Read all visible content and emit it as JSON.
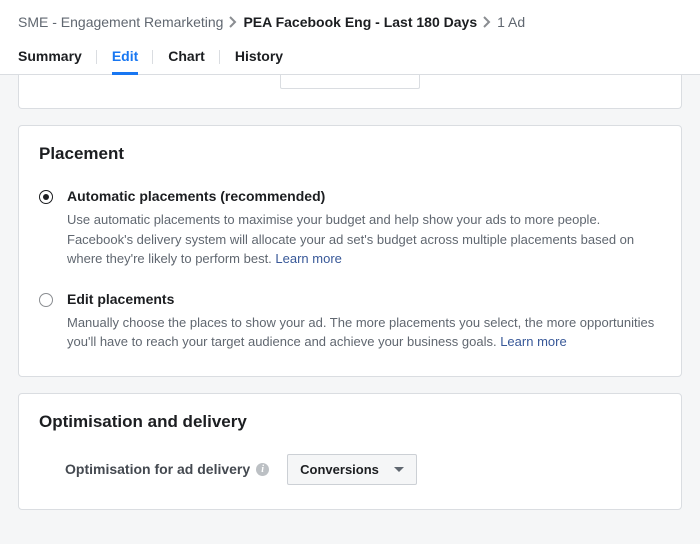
{
  "breadcrumb": {
    "root": "SME - Engagement Remarketing",
    "current": "PEA Facebook Eng - Last 180 Days",
    "tail": "1 Ad"
  },
  "tabs": {
    "summary": "Summary",
    "edit": "Edit",
    "chart": "Chart",
    "history": "History"
  },
  "placement": {
    "heading": "Placement",
    "auto": {
      "title": "Automatic placements (recommended)",
      "desc": "Use automatic placements to maximise your budget and help show your ads to more people. Facebook's delivery system will allocate your ad set's budget across multiple placements based on where they're likely to perform best. ",
      "learn_more": "Learn more"
    },
    "edit": {
      "title": "Edit placements",
      "desc": "Manually choose the places to show your ad. The more placements you select, the more opportunities you'll have to reach your target audience and achieve your business goals. ",
      "learn_more": "Learn more"
    }
  },
  "delivery": {
    "heading": "Optimisation and delivery",
    "opt_label": "Optimisation for ad delivery",
    "opt_value": "Conversions"
  }
}
